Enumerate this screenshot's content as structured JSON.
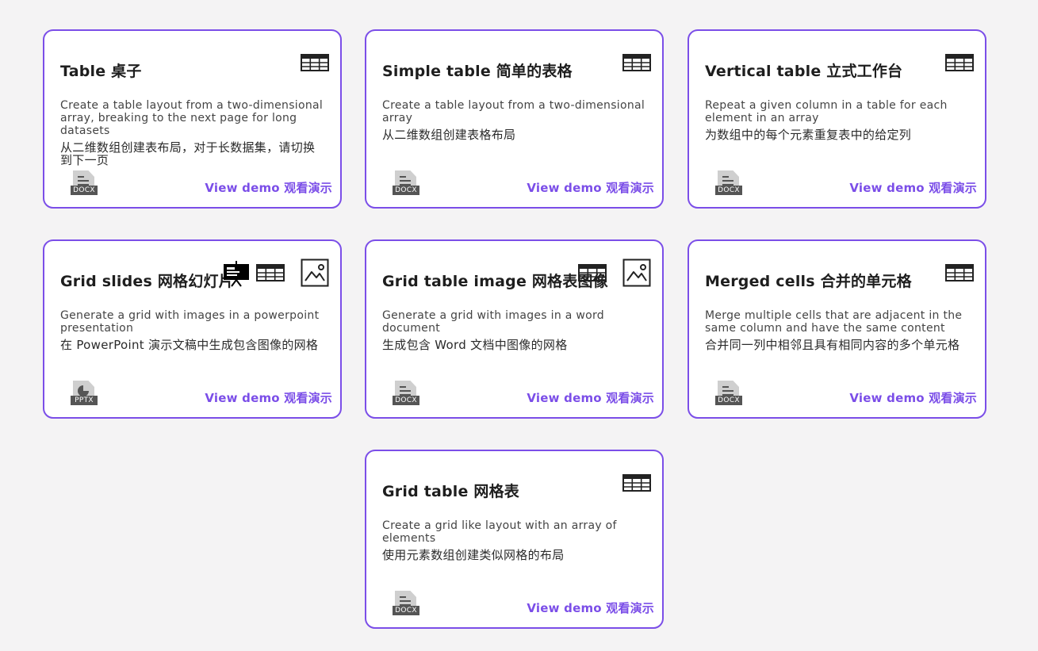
{
  "cards": [
    {
      "title": "Table 桌子",
      "description": "Create a table layout from a two-dimensional array, breaking to the next page for long datasets",
      "description_zh": "从二维数组创建表布局，对于长数据集，请切换到下一页",
      "icons": [
        "table-icon"
      ],
      "file_format": "DOCX",
      "link_label": "View demo 观看演示"
    },
    {
      "title": "Simple table 简单的表格",
      "description": "Create a table layout from a two-dimensional array",
      "description_zh": "从二维数组创建表格布局",
      "icons": [
        "table-icon"
      ],
      "file_format": "DOCX",
      "link_label": "View demo 观看演示"
    },
    {
      "title": "Vertical table 立式工作台",
      "description": "Repeat a given column in a table for each element in an array",
      "description_zh": "为数组中的每个元素重复表中的给定列",
      "icons": [
        "table-icon"
      ],
      "file_format": "DOCX",
      "link_label": "View demo 观看演示"
    },
    {
      "title": "Grid slides 网格幻灯片",
      "description": "Generate a grid with images in a powerpoint presentation",
      "description_zh": "在 PowerPoint 演示文稿中生成包含图像的网格",
      "icons": [
        "slides-icon",
        "table-icon",
        "image-icon"
      ],
      "file_format": "PPTX",
      "link_label": "View demo 观看演示"
    },
    {
      "title": "Grid table image 网格表图像",
      "description": "Generate a grid with images in a word document",
      "description_zh": "生成包含 Word 文档中图像的网格",
      "icons": [
        "table-icon",
        "image-icon"
      ],
      "file_format": "DOCX",
      "link_label": "View demo 观看演示"
    },
    {
      "title": "Merged cells 合并的单元格",
      "description": "Merge multiple cells that are adjacent in the same column and have the same content",
      "description_zh": "合并同一列中相邻且具有相同内容的多个单元格",
      "icons": [
        "table-icon"
      ],
      "file_format": "DOCX",
      "link_label": "View demo 观看演示"
    },
    {
      "title": "Grid table 网格表",
      "description": "Create a grid like layout with an array of elements",
      "description_zh": "使用元素数组创建类似网格的布局",
      "icons": [
        "table-icon"
      ],
      "file_format": "DOCX",
      "link_label": "View demo 观看演示"
    }
  ],
  "colors": {
    "accent": "#7b4ee8",
    "background": "#f4f3f4",
    "card": "#ffffff",
    "title": "#1e1e1e",
    "icon": "#222222",
    "badge": "#555555"
  }
}
